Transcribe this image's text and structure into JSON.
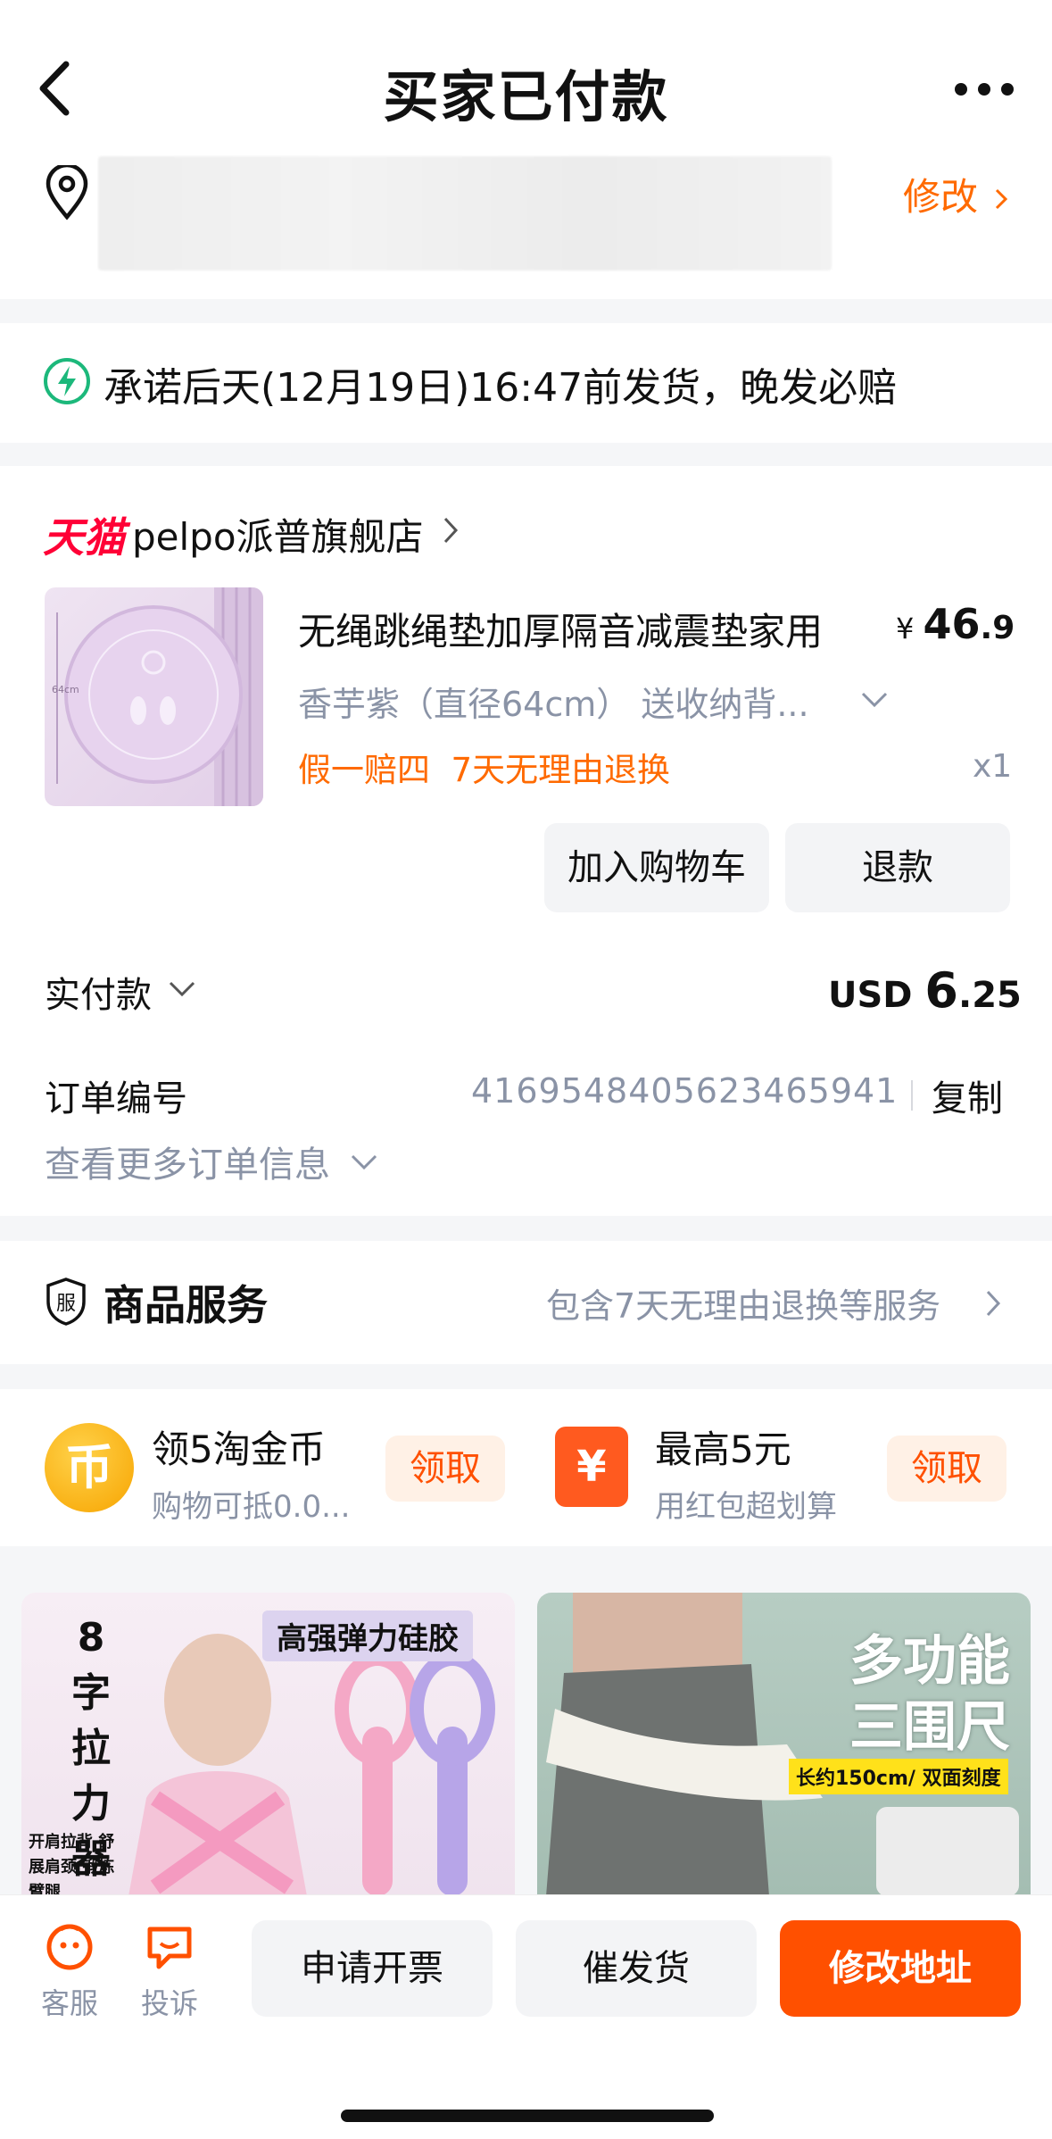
{
  "header": {
    "title": "买家已付款"
  },
  "address": {
    "edit_label": "修改"
  },
  "promise": {
    "text": "承诺后天(12月19日)16:47前发货，晚发必赔"
  },
  "order": {
    "platform_badge": "天猫",
    "store_name": "pelpo派普旗舰店",
    "product": {
      "title": "无绳跳绳垫加厚隔音减震垫家用",
      "price_symbol": "¥ ",
      "price_int": "46",
      "price_dec": ".9",
      "sku": "香芋紫（直径64cm） 送收纳背...",
      "tags": "假一赔四  7天无理由退换",
      "quantity": "x1",
      "thumb_dim": "64cm"
    },
    "buttons": {
      "cart": "加入购物车",
      "refund": "退款"
    },
    "paid": {
      "label": "实付款",
      "currency": "USD ",
      "int": "6",
      "dec": ".25"
    },
    "order_no": {
      "label": "订单编号",
      "value": "4169548405623465941",
      "copy": "复制"
    },
    "more_info": "查看更多订单信息"
  },
  "services": {
    "title": "商品服务",
    "desc": "包含7天无理由退换等服务"
  },
  "coupons": [
    {
      "icon": "币",
      "title": "领5淘金币",
      "sub": "购物可抵0.0...",
      "action": "领取"
    },
    {
      "icon": "¥",
      "title": "最高5元",
      "sub": "用红包超划算",
      "action": "领取"
    }
  ],
  "recommendations": [
    {
      "big": "8字拉力器",
      "tag": "高强弹力硅胶",
      "sub": "开肩拉背 舒展肩颈 锻炼臂腿"
    },
    {
      "big": "多功能 三围尺",
      "tag": "长约150cm/ 双面刻度"
    }
  ],
  "bottom": {
    "service": "客服",
    "complaint": "投诉",
    "invoice": "申请开票",
    "urge": "催发货",
    "edit_address": "修改地址"
  },
  "colors": {
    "accent": "#ff5000",
    "tmall": "#ff0036",
    "muted": "#8a93a6"
  }
}
